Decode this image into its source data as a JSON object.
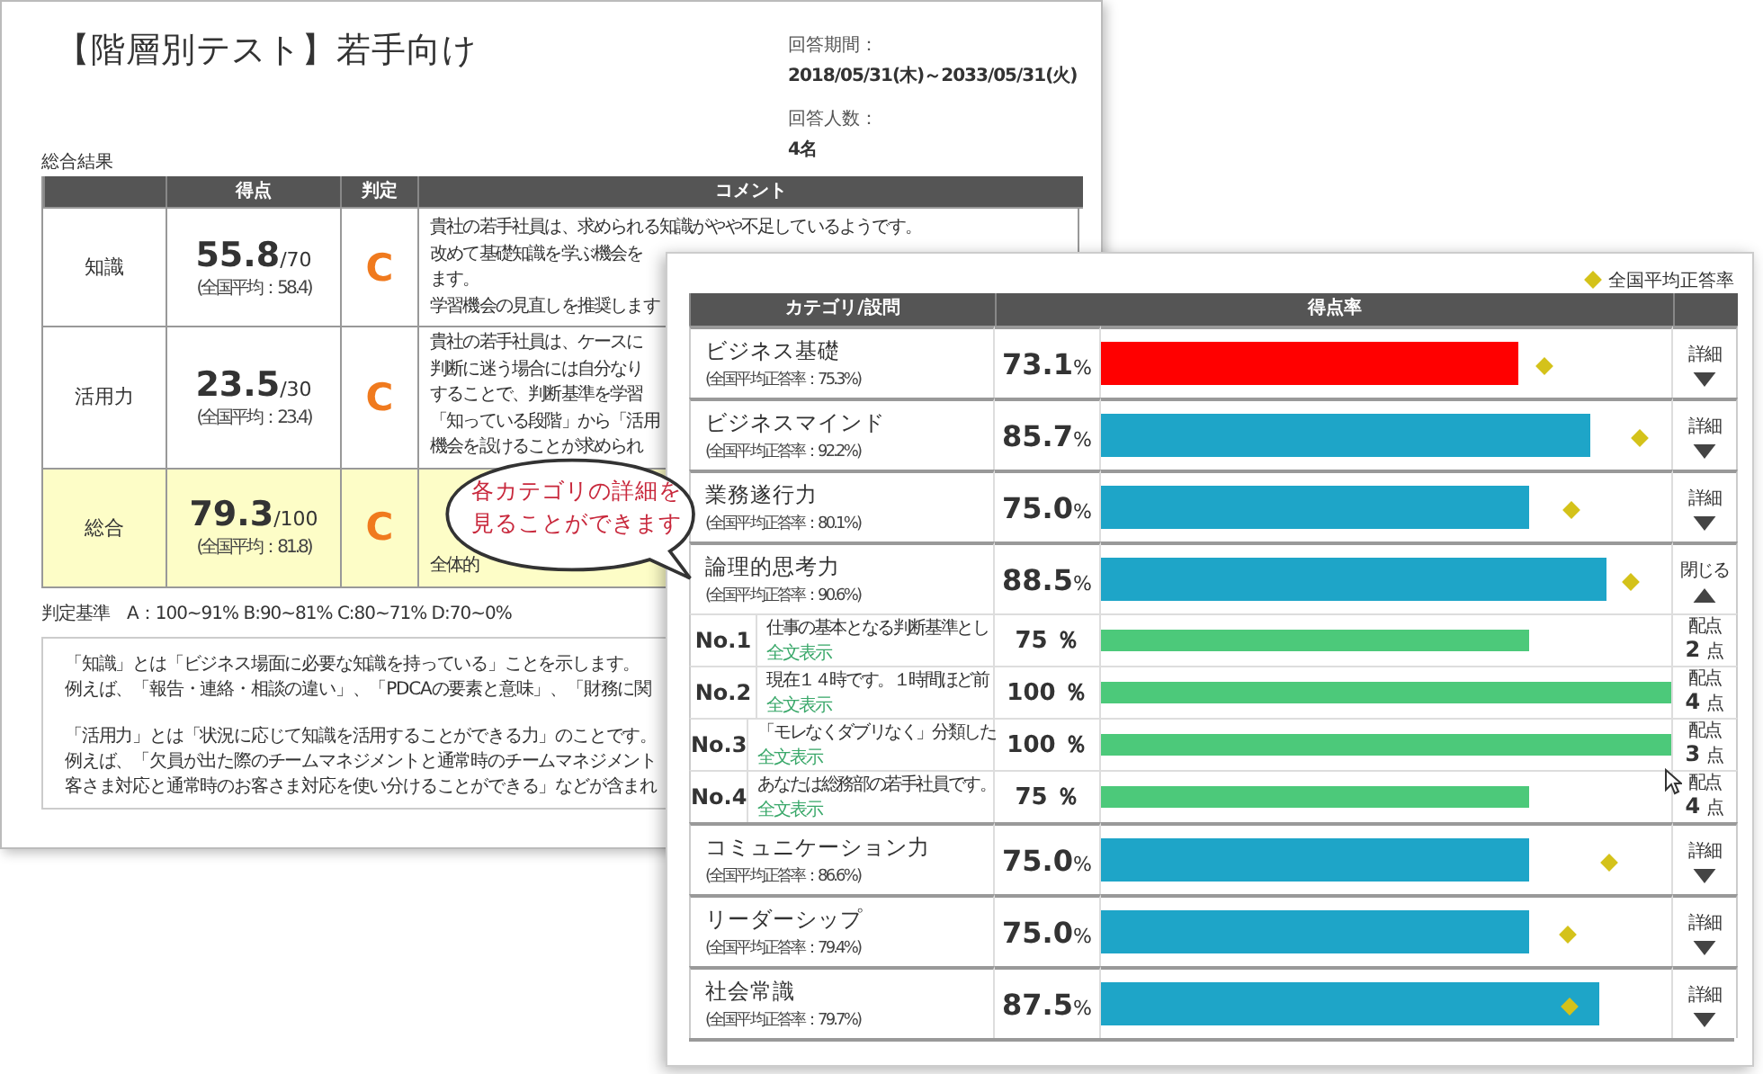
{
  "report": {
    "title": "【階層別テスト】若手向け",
    "period_label": "回答期間：",
    "period": "2018/05/31(木)～2033/05/31(火)",
    "respondents_label": "回答人数：",
    "respondents": "4名",
    "section_title": "総合結果",
    "columns": [
      "得点",
      "判定",
      "コメント"
    ],
    "rows": [
      {
        "label": "知識",
        "score": "55.8",
        "max": "/70",
        "average": "(全国平均：58.4)",
        "grade": "C",
        "highlighted": false,
        "comment": [
          "貴社の若手社員は、求められる知識がやや不足しているようです。",
          "改めて基礎知識を学ぶ機会を",
          "ます。",
          "学習機会の見直しを推奨します"
        ]
      },
      {
        "label": "活用力",
        "score": "23.5",
        "max": "/30",
        "average": "(全国平均：23.4)",
        "grade": "C",
        "highlighted": false,
        "comment": [
          "貴社の若手社員は、ケースに",
          "判断に迷う場合には自分なり",
          "することで、判断基準を学習",
          "「知っている段階」から「活用",
          "機会を設けることが求められ"
        ]
      },
      {
        "label": "総合",
        "score": "79.3",
        "max": "/100",
        "average": "(全国平均：81.8)",
        "grade": "C",
        "highlighted": true,
        "comment": [
          "全体的"
        ]
      }
    ],
    "criteria": "判定基準　A：100~91% B:90~81% C:80~71% D:70~0%",
    "notes": [
      [
        "「知識」とは「ビジネス場面に必要な知識を持っている」ことを示します。",
        "例えば、「報告・連絡・相談の違い」、「PDCAの要素と意味」、「財務に関"
      ],
      [
        "「活用力」とは「状況に応じて知識を活用することができる力」のことです。",
        "例えば、「欠員が出た際のチームマネジメントと通常時のチームマネジメント",
        "客さま対応と通常時のお客さま対応を使い分けることができる」などが含まれ"
      ]
    ]
  },
  "detail": {
    "legend": "全国平均正答率",
    "columns": [
      "カテゴリ/設問",
      "得点率"
    ],
    "categories": [
      {
        "name": "ビジネス基礎",
        "average": "(全国平均正答率：75.3%)",
        "rate": "73.1",
        "unit": "%",
        "level": 0.731,
        "color": "#ff0000",
        "average_marker": {
          "level": 0.753
        },
        "expanded": false,
        "toggle": "詳細"
      },
      {
        "name": "ビジネスマインド",
        "average": "(全国平均正答率：92.2%)",
        "rate": "85.7",
        "unit": "%",
        "level": 0.857,
        "color": "#1ea5c8",
        "average_marker": {
          "level": 0.922
        },
        "expanded": false,
        "toggle": "詳細"
      },
      {
        "name": "業務遂行力",
        "average": "(全国平均正答率：80.1%)",
        "rate": "75.0",
        "unit": "%",
        "level": 0.75,
        "color": "#1ea5c8",
        "average_marker": {
          "level": 0.801
        },
        "expanded": false,
        "toggle": "詳細"
      },
      {
        "name": "論理的思考力",
        "average": "(全国平均正答率：90.6%)",
        "rate": "88.5",
        "unit": "%",
        "level": 0.885,
        "color": "#1ea5c8",
        "average_marker": {
          "level": 0.906
        },
        "expanded": true,
        "toggle": "閉じる",
        "children": [
          {
            "number": "No.1",
            "text": "仕事の基本となる判断基準とし",
            "link": "全文表示",
            "rate": "75",
            "unit": "％",
            "level": 0.75,
            "points_label": "配点",
            "points": "2",
            "points_unit": "点"
          },
          {
            "number": "No.2",
            "text": "現在１４時です。１時間ほど前",
            "link": "全文表示",
            "rate": "100",
            "unit": "％",
            "level": 1.0,
            "points_label": "配点",
            "points": "4",
            "points_unit": "点"
          },
          {
            "number": "No.3",
            "text": "「モレなくダブリなく」分類した",
            "link": "全文表示",
            "rate": "100",
            "unit": "％",
            "level": 1.0,
            "points_label": "配点",
            "points": "3",
            "points_unit": "点"
          },
          {
            "number": "No.4",
            "text": "あなたは総務部の若手社員です。",
            "link": "全文表示",
            "rate": "75",
            "unit": "％",
            "level": 0.75,
            "points_label": "配点",
            "points": "4",
            "points_unit": "点"
          }
        ]
      },
      {
        "name": "コミュニケーション力",
        "average": "(全国平均正答率：86.6%)",
        "rate": "75.0",
        "unit": "%",
        "level": 0.75,
        "color": "#1ea5c8",
        "average_marker": {
          "level": 0.866
        },
        "expanded": false,
        "toggle": "詳細"
      },
      {
        "name": "リーダーシップ",
        "average": "(全国平均正答率：79.4%)",
        "rate": "75.0",
        "unit": "%",
        "level": 0.75,
        "color": "#1ea5c8",
        "average_marker": {
          "level": 0.794
        },
        "expanded": false,
        "toggle": "詳細"
      },
      {
        "name": "社会常識",
        "average": "(全国平均正答率：79.7%)",
        "rate": "87.5",
        "unit": "%",
        "level": 0.875,
        "color": "#1ea5c8",
        "average_marker": {
          "level": 0.797
        },
        "expanded": false,
        "toggle": "詳細"
      }
    ]
  },
  "callout": {
    "text": "各カテゴリの詳細を見ることができます"
  }
}
